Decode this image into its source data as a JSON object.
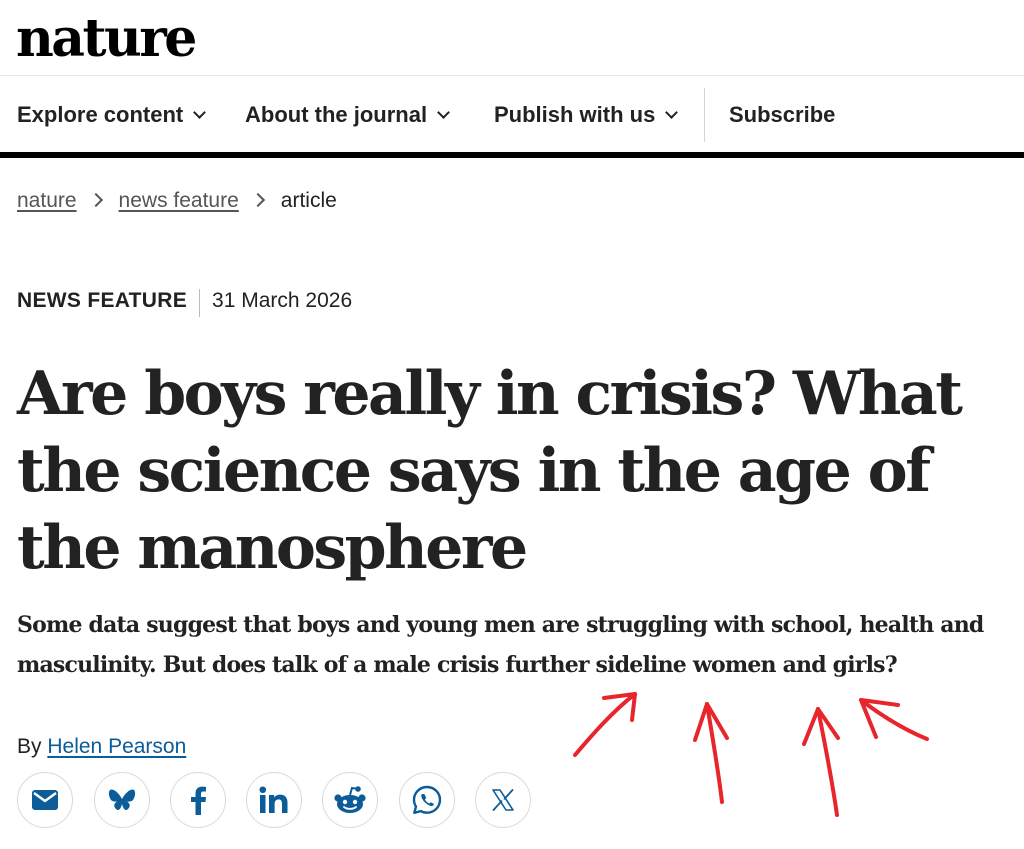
{
  "header": {
    "logo_text": "nature"
  },
  "nav": {
    "items": [
      {
        "label": "Explore content",
        "has_dropdown": true
      },
      {
        "label": "About the journal",
        "has_dropdown": true
      },
      {
        "label": "Publish with us",
        "has_dropdown": true
      },
      {
        "label": "Subscribe",
        "has_dropdown": false
      }
    ]
  },
  "breadcrumb": {
    "items": [
      "nature",
      "news feature",
      "article"
    ]
  },
  "article": {
    "type": "NEWS FEATURE",
    "date": "31 March 2026",
    "title": "Are boys really in crisis? What the science says in the age of the manosphere",
    "standfirst": "Some data suggest that boys and young men are struggling with school, health and masculinity. But does talk of a male crisis further sideline women and girls?",
    "byline_prefix": "By",
    "author": "Helen Pearson"
  },
  "share": {
    "icons": [
      "email-icon",
      "bluesky-icon",
      "facebook-icon",
      "linkedin-icon",
      "reddit-icon",
      "whatsapp-icon",
      "x-icon"
    ]
  },
  "colors": {
    "text": "#222222",
    "link": "#0b5c99",
    "icon": "#0b5c99",
    "rule": "#000000",
    "annotation": "#e8252a"
  }
}
